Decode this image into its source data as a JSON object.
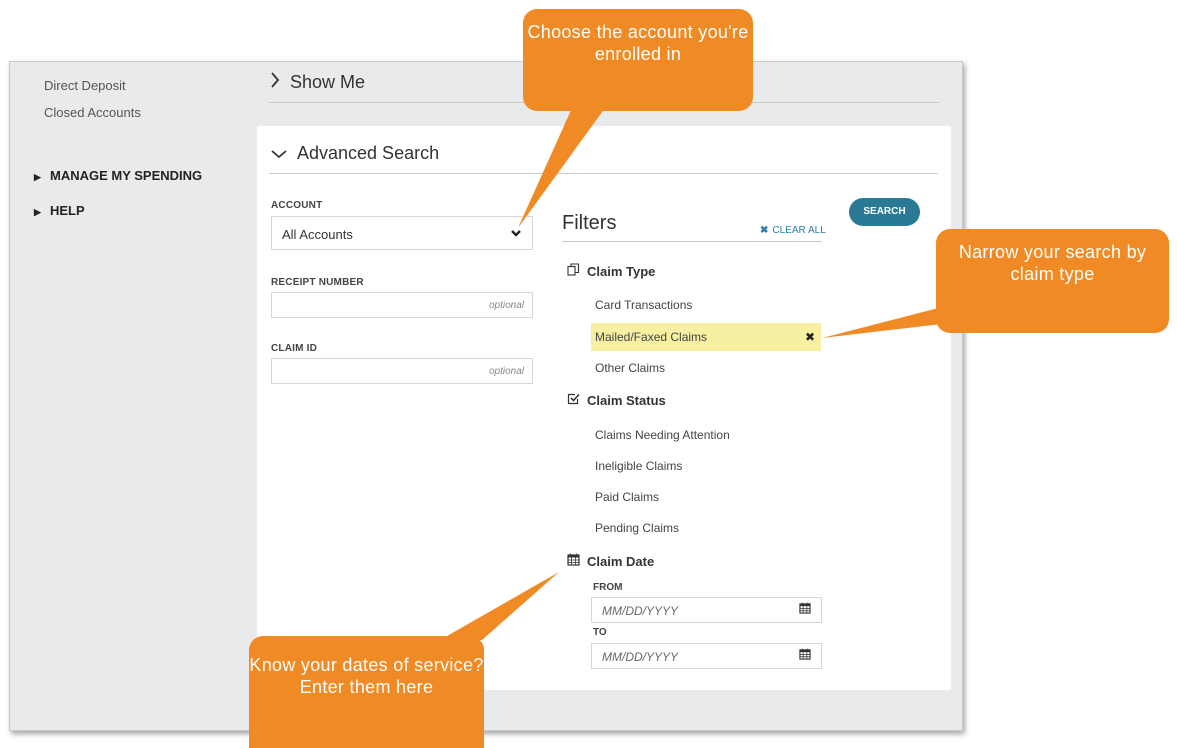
{
  "sidebar": {
    "links": [
      "Direct Deposit",
      "Closed Accounts"
    ],
    "sections": [
      "MANAGE MY SPENDING",
      "HELP"
    ]
  },
  "show_me": {
    "label": "Show Me"
  },
  "advanced_search": {
    "title": "Advanced Search",
    "account": {
      "label": "ACCOUNT",
      "value": "All Accounts"
    },
    "receipt_number": {
      "label": "RECEIPT NUMBER",
      "placeholder": "optional"
    },
    "claim_id": {
      "label": "CLAIM ID",
      "placeholder": "optional"
    },
    "search_button": "SEARCH"
  },
  "filters": {
    "title": "Filters",
    "clear_all": "CLEAR ALL",
    "claim_type": {
      "title": "Claim Type",
      "options": [
        "Card Transactions",
        "Mailed/Faxed Claims",
        "Other Claims"
      ],
      "selected": "Mailed/Faxed Claims"
    },
    "claim_status": {
      "title": "Claim Status",
      "options": [
        "Claims Needing Attention",
        "Ineligible Claims",
        "Paid Claims",
        "Pending Claims"
      ]
    },
    "claim_date": {
      "title": "Claim Date",
      "from_label": "FROM",
      "to_label": "TO",
      "from_placeholder": "MM/DD/YYYY",
      "to_placeholder": "MM/DD/YYYY"
    }
  },
  "callouts": {
    "account": "Choose the account you're enrolled in",
    "claim_type": "Narrow your search by claim type",
    "dates": "Know your dates of service? Enter them here"
  },
  "colors": {
    "callout": "#f08a24",
    "search_button": "#2a7a96",
    "selected_highlight": "#f7f0a2",
    "link_blue": "#2a7ea8"
  },
  "icons": {
    "show_me_chevron": "chevron-right-icon",
    "advanced_search_chevron": "chevron-down-icon",
    "account_dropdown": "chevron-down-icon",
    "claim_type": "copy-icon",
    "claim_status": "check-square-icon",
    "claim_date": "calendar-icon",
    "clear_all": "close-icon",
    "remove_filter": "close-icon"
  }
}
